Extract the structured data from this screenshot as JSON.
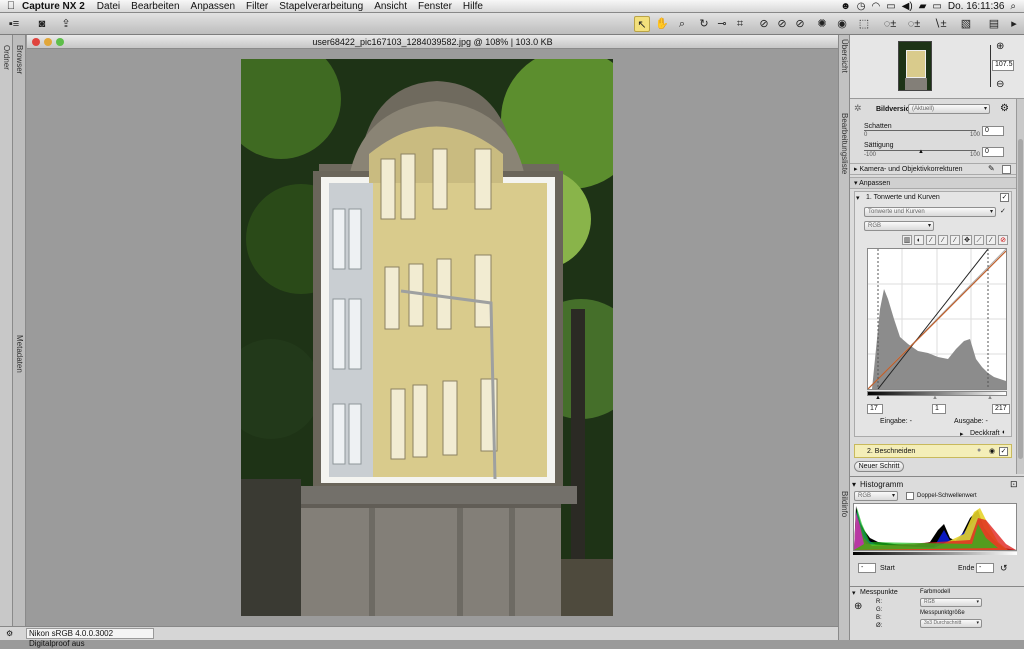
{
  "menubar": {
    "app": "Capture NX 2",
    "items": [
      "Datei",
      "Bearbeiten",
      "Anpassen",
      "Filter",
      "Stapelverarbeitung",
      "Ansicht",
      "Fenster",
      "Hilfe"
    ],
    "clock": "Do. 16:11:36"
  },
  "left": {
    "browser": "Browser",
    "ordner": "Ordner",
    "metadaten": "Metadaten"
  },
  "document": {
    "title": "user68422_pic167103_1284039582.jpg @ 108% | 103.0 KB"
  },
  "status": {
    "profile": "Nikon sRGB 4.0.0.3002 Digitalproof aus"
  },
  "navigator": {
    "label": "Übersicht",
    "zoom": "107.5"
  },
  "edit": {
    "label": "Bearbeitungsliste",
    "bildversion_label": "Bildversion",
    "bildversion_value": "(Aktuell)",
    "schatten": "Schatten",
    "schatten_value": "0",
    "schatten_min": "0",
    "schatten_max": "100",
    "saettigung": "Sättigung",
    "saettigung_value": "0",
    "saettigung_min": "-100",
    "saettigung_max": "100",
    "kamera": "Kamera- und Objektivkorrekturen",
    "anpassen": "Anpassen",
    "step1": "1. Tonwerte und Kurven",
    "step1_dd": "Tonwerte und Kurven",
    "channel": "RGB",
    "black": "17",
    "mid": "1",
    "white": "217",
    "eingabe": "Eingabe: -",
    "ausgabe": "Ausgabe: -",
    "deckkraft": "Deckkraft",
    "step2": "2. Beschneiden",
    "new_step": "Neuer Schritt"
  },
  "histogram": {
    "label": "Histogramm",
    "panel_label": "Bildinfo",
    "channel": "RGB",
    "double": "Doppel-Schwellenwert",
    "start_value": "-",
    "start": "Start",
    "end": "Ende",
    "end_value": "-"
  },
  "messpunkte": {
    "title": "Messpunkte",
    "r": "R:",
    "g": "G:",
    "b": "B:",
    "o": "Ø:",
    "farbmodell": "Farbmodell",
    "farb_value": "RGB",
    "groesse": "Messpunktgröße",
    "groesse_value": "3x3 Durchschnitt"
  }
}
